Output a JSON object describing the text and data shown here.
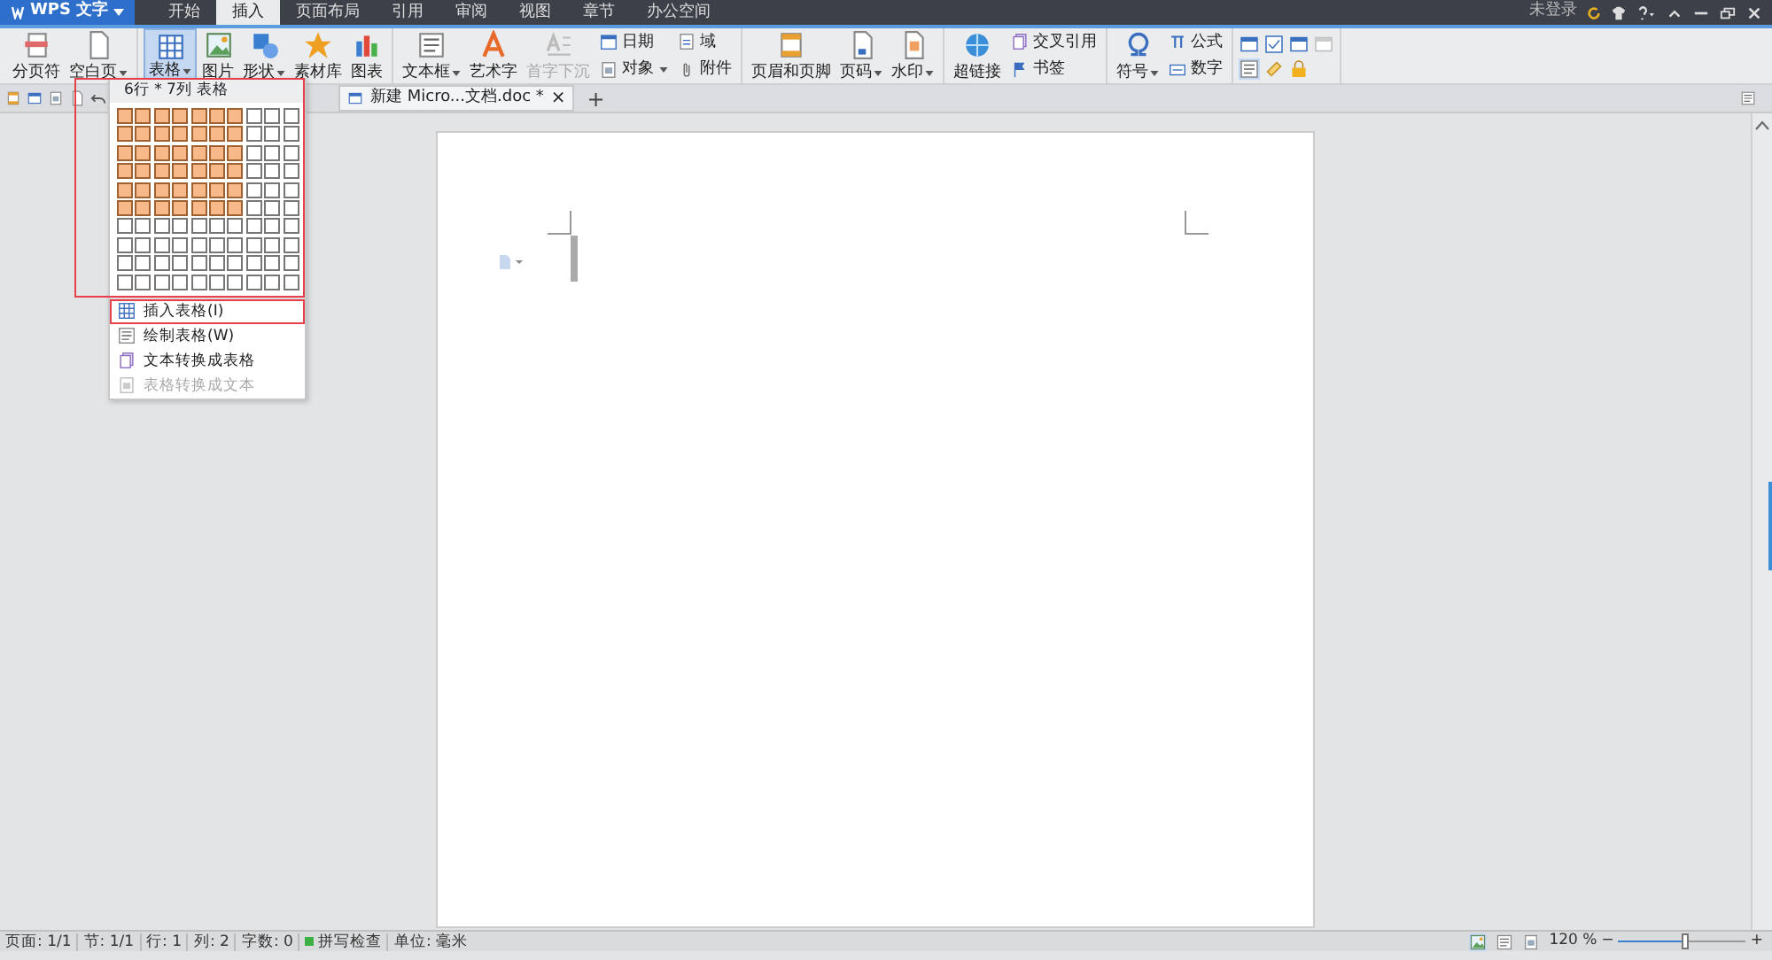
{
  "app_menu": {
    "label": "WPS 文字"
  },
  "menu_tabs": [
    {
      "label": "开始",
      "selected": false
    },
    {
      "label": "插入",
      "selected": true
    },
    {
      "label": "页面布局",
      "selected": false
    },
    {
      "label": "引用",
      "selected": false
    },
    {
      "label": "审阅",
      "selected": false
    },
    {
      "label": "视图",
      "selected": false
    },
    {
      "label": "章节",
      "selected": false
    },
    {
      "label": "办公空间",
      "selected": false
    }
  ],
  "account": {
    "label": "未登录"
  },
  "ribbon_groups": [
    {
      "buttons": [
        {
          "kind": "large",
          "label": "分页符",
          "dropdown": false,
          "active": false,
          "disabled": false
        },
        {
          "kind": "large",
          "label": "空白页",
          "dropdown": true,
          "active": false,
          "disabled": false
        }
      ]
    },
    {
      "buttons": [
        {
          "kind": "large",
          "label": "表格",
          "dropdown": true,
          "active": true,
          "disabled": false
        },
        {
          "kind": "large",
          "label": "图片",
          "dropdown": false,
          "active": false,
          "disabled": false
        },
        {
          "kind": "large",
          "label": "形状",
          "dropdown": true,
          "active": false,
          "disabled": false
        },
        {
          "kind": "large",
          "label": "素材库",
          "dropdown": false,
          "active": false,
          "disabled": false
        },
        {
          "kind": "large",
          "label": "图表",
          "dropdown": false,
          "active": false,
          "disabled": false
        }
      ]
    },
    {
      "buttons": [
        {
          "kind": "large",
          "label": "文本框",
          "dropdown": true,
          "active": false,
          "disabled": false
        },
        {
          "kind": "large",
          "label": "艺术字",
          "dropdown": false,
          "active": false,
          "disabled": false
        },
        {
          "kind": "large",
          "label": "首字下沉",
          "dropdown": false,
          "active": false,
          "disabled": true
        },
        {
          "kind": "small",
          "label": "日期",
          "dropdown": false,
          "active": false,
          "disabled": false
        },
        {
          "kind": "small",
          "label": "对象",
          "dropdown": true,
          "active": false,
          "disabled": false
        },
        {
          "kind": "small",
          "label": "域",
          "dropdown": false,
          "active": false,
          "disabled": false
        },
        {
          "kind": "small",
          "label": "附件",
          "dropdown": false,
          "active": false,
          "disabled": false
        }
      ]
    },
    {
      "buttons": [
        {
          "kind": "large",
          "label": "页眉和页脚",
          "dropdown": false,
          "active": false,
          "disabled": false
        },
        {
          "kind": "large",
          "label": "页码",
          "dropdown": true,
          "active": false,
          "disabled": false
        },
        {
          "kind": "large",
          "label": "水印",
          "dropdown": true,
          "active": false,
          "disabled": false
        }
      ]
    },
    {
      "buttons": [
        {
          "kind": "large",
          "label": "超链接",
          "dropdown": false,
          "active": false,
          "disabled": false
        },
        {
          "kind": "small",
          "label": "交叉引用",
          "dropdown": false,
          "active": false,
          "disabled": false
        },
        {
          "kind": "small",
          "label": "书签",
          "dropdown": false,
          "active": false,
          "disabled": false
        }
      ]
    },
    {
      "buttons": [
        {
          "kind": "large",
          "label": "符号",
          "dropdown": true,
          "active": false,
          "disabled": false
        },
        {
          "kind": "small",
          "label": "公式",
          "dropdown": false,
          "active": false,
          "disabled": false
        },
        {
          "kind": "small",
          "label": "数字",
          "dropdown": false,
          "active": false,
          "disabled": false
        }
      ]
    },
    {
      "buttons": [
        {
          "kind": "icon",
          "active": false,
          "disabled": false
        },
        {
          "kind": "icon",
          "active": false,
          "disabled": false
        },
        {
          "kind": "icon",
          "active": false,
          "disabled": false
        },
        {
          "kind": "icon",
          "active": false,
          "disabled": true
        },
        {
          "kind": "icon",
          "active": true,
          "disabled": false
        },
        {
          "kind": "icon",
          "active": false,
          "disabled": false
        },
        {
          "kind": "icon",
          "active": false,
          "disabled": false
        }
      ]
    }
  ],
  "document_tab": {
    "label": "新建 Micro...文档.doc *",
    "close": "×"
  },
  "new_tab": "+",
  "table_menu": {
    "header": "6行 * 7列 表格",
    "outlined": true,
    "grid": [
      {
        "highlighted": [
          true,
          true,
          true,
          true,
          true,
          true,
          true,
          false,
          false,
          false
        ]
      },
      {
        "highlighted": [
          true,
          true,
          true,
          true,
          true,
          true,
          true,
          false,
          false,
          false
        ]
      },
      {
        "highlighted": [
          true,
          true,
          true,
          true,
          true,
          true,
          true,
          false,
          false,
          false
        ]
      },
      {
        "highlighted": [
          true,
          true,
          true,
          true,
          true,
          true,
          true,
          false,
          false,
          false
        ]
      },
      {
        "highlighted": [
          true,
          true,
          true,
          true,
          true,
          true,
          true,
          false,
          false,
          false
        ]
      },
      {
        "highlighted": [
          true,
          true,
          true,
          true,
          true,
          true,
          true,
          false,
          false,
          false
        ]
      },
      {
        "highlighted": [
          false,
          false,
          false,
          false,
          false,
          false,
          false,
          false,
          false,
          false
        ]
      },
      {
        "highlighted": [
          false,
          false,
          false,
          false,
          false,
          false,
          false,
          false,
          false,
          false
        ]
      },
      {
        "highlighted": [
          false,
          false,
          false,
          false,
          false,
          false,
          false,
          false,
          false,
          false
        ]
      },
      {
        "highlighted": [
          false,
          false,
          false,
          false,
          false,
          false,
          false,
          false,
          false,
          false
        ]
      }
    ],
    "items": [
      {
        "label": "插入表格(I)",
        "disabled": false,
        "outlined": true
      },
      {
        "label": "绘制表格(W)",
        "disabled": false,
        "outlined": false
      },
      {
        "label": "文本转换成表格",
        "disabled": false,
        "outlined": false
      },
      {
        "label": "表格转换成文本",
        "disabled": true,
        "outlined": false
      }
    ]
  },
  "status_bar": {
    "fields": [
      "页面: 1/1",
      "节: 1/1",
      "行: 1",
      "列: 2",
      "字数: 0"
    ],
    "spell_check": {
      "label": "拼写检查",
      "on": true
    },
    "unit": "单位: 毫米",
    "zoom": "120 %",
    "zoom_minus": "−",
    "zoom_plus": "+",
    "zoom_slider": {
      "level": 0.52
    }
  }
}
